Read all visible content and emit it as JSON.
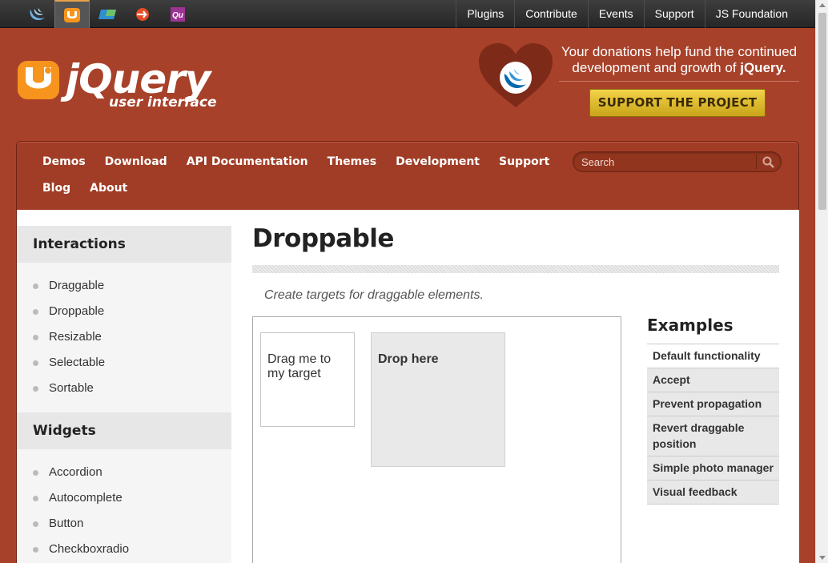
{
  "topbar": {
    "projects": [
      {
        "name": "jquery-icon"
      },
      {
        "name": "jquery-ui-icon"
      },
      {
        "name": "jquery-mobile-icon"
      },
      {
        "name": "sizzle-icon"
      },
      {
        "name": "qunit-icon",
        "text": "Qu"
      }
    ],
    "links": [
      "Plugins",
      "Contribute",
      "Events",
      "Support",
      "JS Foundation"
    ]
  },
  "header": {
    "logo_word": "jQuery",
    "logo_sub": "user interface",
    "donation_line1": "Your donations help fund the continued",
    "donation_line2_prefix": "development and growth of ",
    "donation_brand": "jQuery.",
    "support_button": "SUPPORT THE PROJECT"
  },
  "nav": {
    "items": [
      "Demos",
      "Download",
      "API Documentation",
      "Themes",
      "Development",
      "Support",
      "Blog",
      "About"
    ],
    "search_placeholder": "Search"
  },
  "sidebar": {
    "sections": [
      {
        "title": "Interactions",
        "items": [
          "Draggable",
          "Droppable",
          "Resizable",
          "Selectable",
          "Sortable"
        ]
      },
      {
        "title": "Widgets",
        "items": [
          "Accordion",
          "Autocomplete",
          "Button",
          "Checkboxradio"
        ]
      }
    ]
  },
  "main": {
    "title": "Droppable",
    "description": "Create targets for draggable elements.",
    "demo": {
      "draggable_text": "Drag me to my target",
      "droppable_text": "Drop here"
    },
    "examples": {
      "title": "Examples",
      "items": [
        "Default functionality",
        "Accept",
        "Prevent propagation",
        "Revert draggable position",
        "Simple photo manager",
        "Visual feedback"
      ]
    }
  },
  "colors": {
    "brand": "#a8412a",
    "topbar": "#2f2f2f",
    "support_button": "#e3c02d",
    "accent_orange": "#f7941d"
  }
}
